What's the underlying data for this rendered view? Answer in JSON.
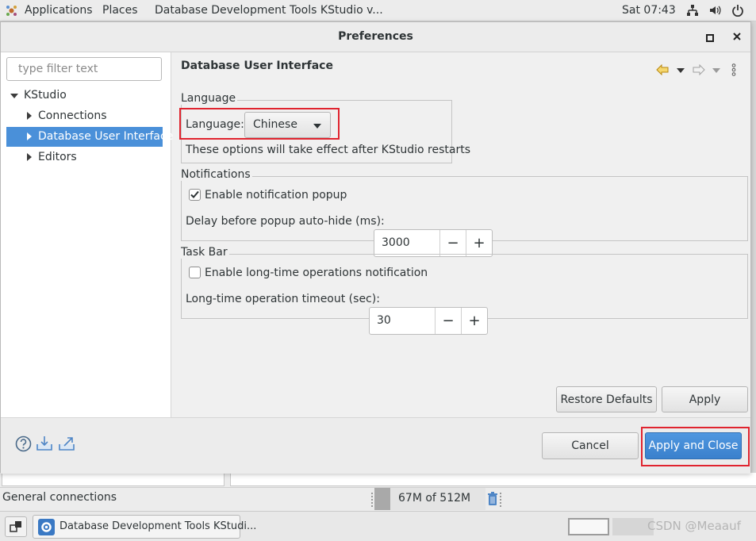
{
  "top_panel": {
    "applications": "Applications",
    "places": "Places",
    "window_title": "Database Development Tools KStudio v...",
    "clock": "Sat 07:43"
  },
  "dialog": {
    "title": "Preferences",
    "filter_placeholder": "type filter text",
    "tree": {
      "root": "KStudio",
      "children": [
        "Connections",
        "Database User Interface",
        "Editors"
      ],
      "selected": "Database User Interface"
    },
    "page_title": "Database User Interface",
    "language_group": {
      "legend": "Language",
      "label": "Language:",
      "value": "Chinese",
      "note": "These options will take effect after KStudio restarts"
    },
    "notifications_group": {
      "legend": "Notifications",
      "enable_label": "Enable notification popup",
      "enable_checked": true,
      "delay_label": "Delay before popup auto-hide (ms):",
      "delay_value": "3000"
    },
    "taskbar_group": {
      "legend": "Task Bar",
      "enable_label": "Enable long-time operations notification",
      "enable_checked": false,
      "timeout_label": "Long-time operation timeout (sec):",
      "timeout_value": "30"
    },
    "restore_defaults_label": "Restore Defaults",
    "apply_label": "Apply",
    "cancel_label": "Cancel",
    "apply_close_label": "Apply and Close"
  },
  "status": {
    "left_text": "General connections",
    "memory": "67M of 512M"
  },
  "taskbar": {
    "window_label": "Database Development Tools KStudi...",
    "watermark": "CSDN @Meaauf"
  },
  "colors": {
    "selection": "#4a90d9",
    "primary_button": "#3a80cc",
    "highlight_box": "#e0242f"
  }
}
